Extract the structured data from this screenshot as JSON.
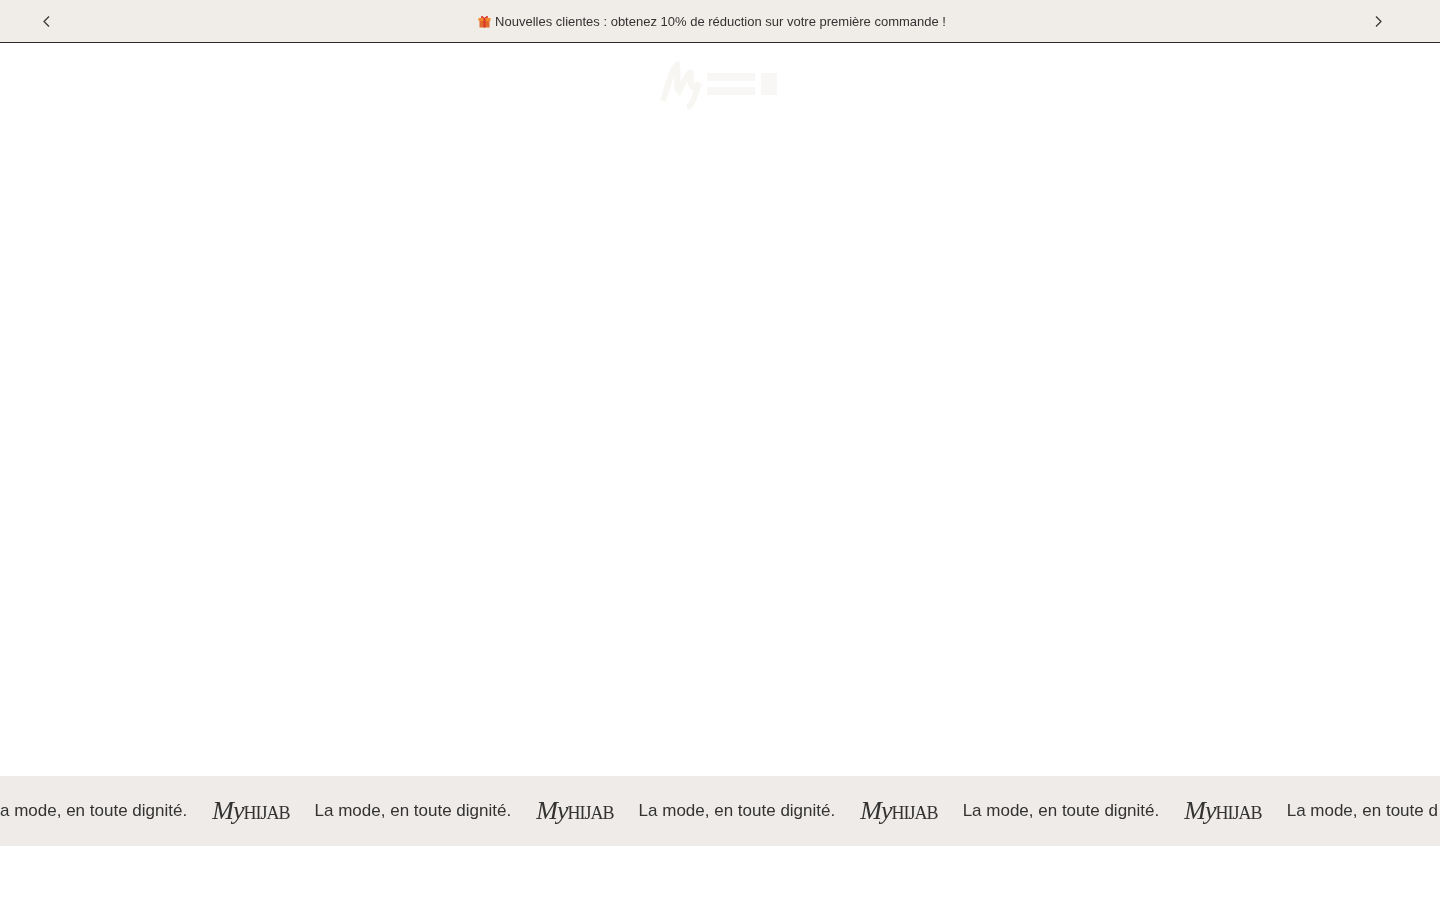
{
  "announcement_bar": {
    "message": "Nouvelles clientes : obtenez 10% de réduction sur votre première commande !"
  },
  "marquee": {
    "items": [
      {
        "kind": "text",
        "text": "a mode, en toute dignité."
      },
      {
        "kind": "logo",
        "script": "My",
        "wordmark": "HIJAB"
      },
      {
        "kind": "text",
        "text": "La mode, en toute dignité."
      },
      {
        "kind": "logo",
        "script": "My",
        "wordmark": "HIJAB"
      },
      {
        "kind": "text",
        "text": "La mode, en toute dignité."
      },
      {
        "kind": "logo",
        "script": "My",
        "wordmark": "HIJAB"
      },
      {
        "kind": "text",
        "text": "La mode, en toute dignité."
      },
      {
        "kind": "logo",
        "script": "My",
        "wordmark": "HIJAB"
      },
      {
        "kind": "text",
        "text": "La mode, en toute d"
      }
    ]
  }
}
